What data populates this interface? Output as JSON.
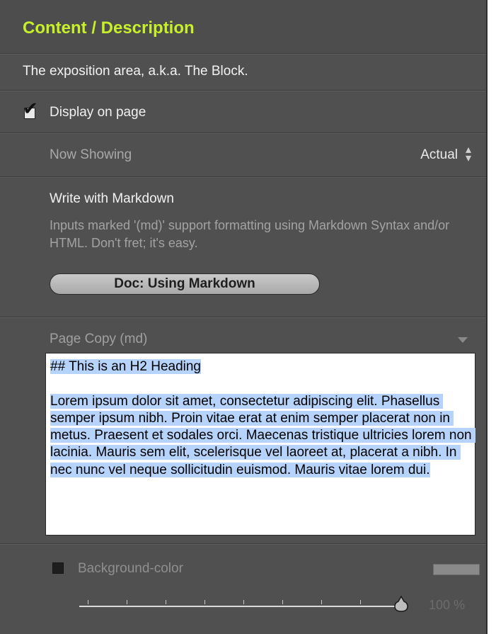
{
  "panel": {
    "title": "Content / Description",
    "description": "The exposition area, a.k.a. The Block."
  },
  "display_on_page": {
    "label": "Display on page",
    "checked": true
  },
  "now_showing": {
    "label": "Now Showing",
    "value": "Actual"
  },
  "markdown": {
    "heading": "Write with Markdown",
    "help": "Inputs marked '(md)' support formatting using Markdown Syntax and/or HTML. Don't fret; it's easy.",
    "doc_button": "Doc: Using Markdown"
  },
  "page_copy": {
    "label": "Page Copy (md)",
    "content": "## This is an H2 Heading\n\nLorem ipsum dolor sit amet, consectetur adipiscing elit. Phasellus semper ipsum nibh. Proin vitae erat at enim semper placerat non in metus. Praesent et sodales orci. Maecenas tristique ultricies lorem non lacinia. Mauris sem elit, scelerisque vel laoreet at, placerat a nibh. In nec nunc vel neque sollicitudin euismod. Mauris vitae lorem dui."
  },
  "background_color": {
    "label": "Background-color",
    "checked": false,
    "swatch_color": "#8a8a8a",
    "opacity_value": 100,
    "opacity_label": "100 %"
  },
  "colors": {
    "accent": "#c8f02a",
    "panel": "#505050",
    "selection": "#b6d4fb"
  },
  "icons": {
    "checkbox": "checkmark-icon",
    "select": "updown-arrows-icon",
    "collapse": "triangle-down-icon",
    "slider": "slider-thumb-icon"
  }
}
